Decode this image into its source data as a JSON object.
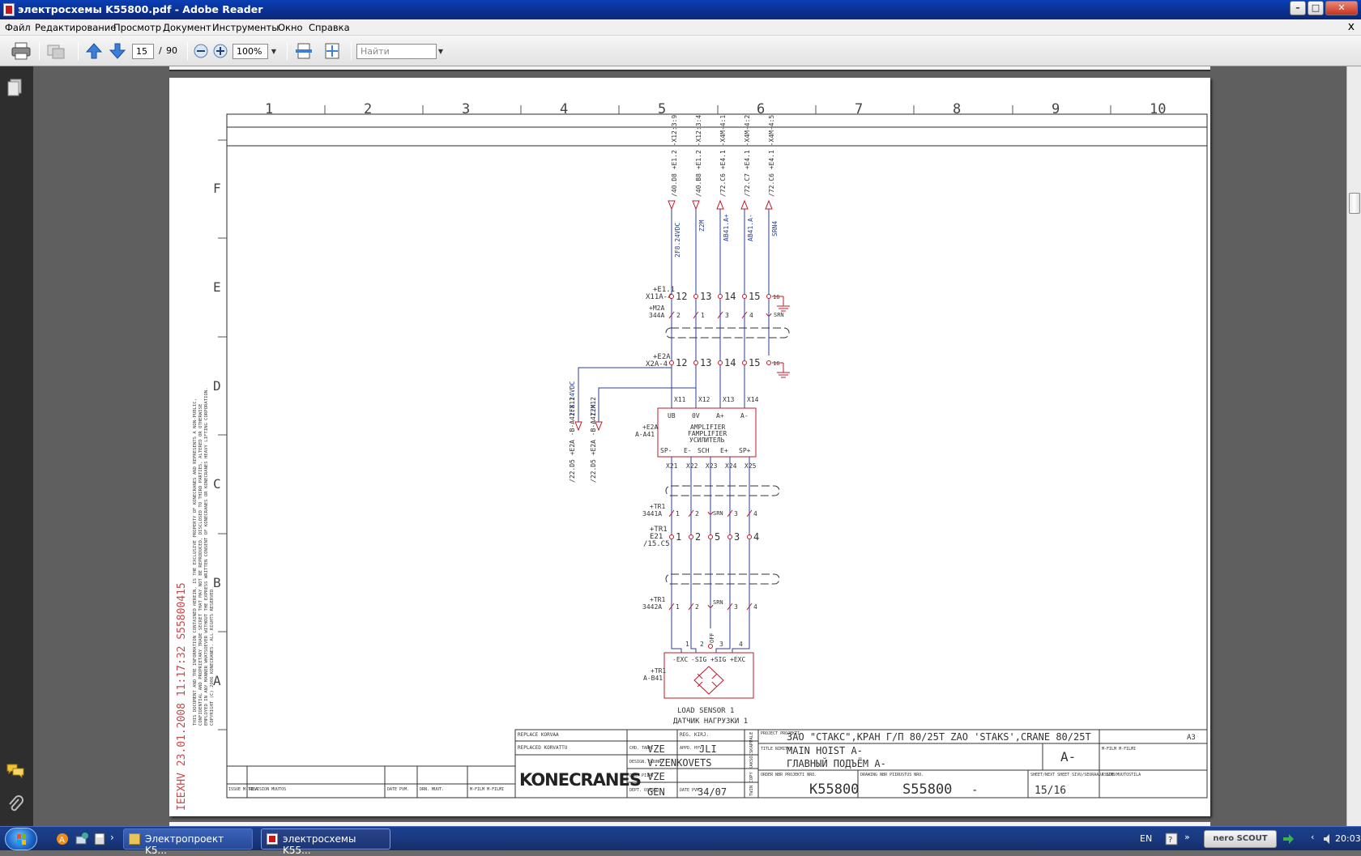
{
  "window": {
    "title": "электросхемы K55800.pdf - Adobe Reader",
    "controls": {
      "minimize": "–",
      "maximize": "□",
      "close": "✕"
    }
  },
  "menu": {
    "items": [
      "Файл",
      "Редактирование",
      "Просмотр",
      "Документ",
      "Инструменты",
      "Окно",
      "Справка"
    ],
    "close_doc": "x"
  },
  "toolbar": {
    "page_current": "15",
    "page_separator": "/",
    "page_total": "90",
    "zoom": "100%",
    "search_placeholder": "Найти"
  },
  "drawing": {
    "columns": [
      "1",
      "2",
      "3",
      "4",
      "5",
      "6",
      "7",
      "8",
      "9",
      "10"
    ],
    "rows": [
      "F",
      "E",
      "D",
      "C",
      "B",
      "A"
    ],
    "top_refs": [
      "/40.D8 +E1.2 -X12:3:9",
      "/40.B8 +E1.2 -X12:3:4",
      "/72.C6 +E4.1 -X4M-4:1",
      "/72.C7 +E4.1 -X4M-4:2",
      "/72.C6 +E4.1 -X4M-4:5"
    ],
    "wire_labels": [
      "2F8.24VDC",
      "Z2M",
      "AB41.A+",
      "AB41.A-",
      "SRN4"
    ],
    "x11a": {
      "loc": "+E1.1",
      "tag": "X11A-4",
      "terms": [
        "12",
        "13",
        "14",
        "15",
        "16"
      ]
    },
    "cable344a": {
      "loc": "+M2A",
      "tag": "344A",
      "cores": [
        "2",
        "1",
        "3",
        "4",
        "SRN"
      ]
    },
    "x2a": {
      "loc": "+E2A",
      "tag": "X2A-4",
      "terms": [
        "12",
        "13",
        "14",
        "15",
        "16"
      ]
    },
    "left_refs": [
      "2F8.24VDC",
      "Z2M",
      "/22.D5 +E2A -B-A41:X11",
      "/22.D5 +E2A -B-A41:X12"
    ],
    "amplifier": {
      "top_terms": [
        "X11",
        "X12",
        "X13",
        "X14"
      ],
      "top_pins": [
        "UB",
        "0V",
        "A+",
        "A-"
      ],
      "loc": "+E2A",
      "tag": "A-A41",
      "name_lines": [
        "AMPLIFIER",
        "FAMPLIFIER",
        "УСИЛИТЕЛЬ"
      ],
      "bottom_pins": [
        "SP-",
        "E-",
        "SCH",
        "E+",
        "SP+"
      ],
      "bottom_terms": [
        "X21",
        "X22",
        "X23",
        "X24",
        "X25"
      ]
    },
    "cable3441a": {
      "loc": "+TR1",
      "tag": "3441A",
      "cores": [
        "1",
        "2",
        "SRN",
        "3",
        "4"
      ]
    },
    "e21": {
      "loc": "+TR1",
      "tag": "E21",
      "ref": "/15.C5",
      "terms": [
        "1",
        "2",
        "5",
        "3",
        "4"
      ]
    },
    "cable3442a": {
      "loc": "+TR1",
      "tag": "3442A",
      "cores": [
        "1",
        "2",
        "SRN",
        "3",
        "4"
      ]
    },
    "sensor": {
      "terms": [
        "1",
        "2",
        "3",
        "4"
      ],
      "off": "OFF",
      "pins": [
        "-EXC",
        "-SIG",
        "+SIG",
        "+EXC"
      ],
      "loc": "+TR1",
      "tag": "A-B41",
      "caption1": "LOAD SENSOR 1",
      "caption2": "ДАТЧИК НАГРУЗКИ 1"
    },
    "margin_stamp": "IEEXHV 23.01.2008 11:17:32 S55800415",
    "copyright_lines": [
      "THIS DOCUMENT AND THE INFORMATION CONTAINED HEREIN, IS THE EXCLUSIVE PROPERTY OF KONECRANES AND REPRESENTS A NON-PUBLIC,",
      "CONFIDENTIAL AND PROPRIETARY TRADE SECRET THAT MAY NOT BE REPRODUCED, DISCLOSED TO THIRD PARTIES, ALTERED OR OTHERWISE",
      "EMPLOYED IN ANY MANNER WHATSOEVER WITHOUT THE EXPRESS WRITTEN CONSENT OF KONECRANES OR KONECRANES HEAVY LIFTING CORPORATION.",
      "COPYRIGHT (C) 2006 KONECRANES. ALL RIGHTS RESERVED."
    ],
    "title_block": {
      "replace": "REPLACE KORVAA",
      "replaced": "REPLACED KORVATTU",
      "reg": "REG. KIRJ.",
      "chk_lbl": "CHD. TARK.",
      "chk": "VZE",
      "app_lbl": "APPD. HYV.",
      "app": "JLI",
      "design_lbl": "DESIGN. SUUNN.",
      "design": "V.ZENKOVETS",
      "drw_lbl": "DRW. PIIRT.",
      "drw": "VZE",
      "dept_lbl": "DEPT. OSASTO",
      "dept": "GEN",
      "date_lbl": "DATE PVM.",
      "date": "34/07",
      "logo": "KONECRANES",
      "twin": "TWIN COPY KAKSOISKAPPALE",
      "project_lbl": "PROJECT PROJEKTI",
      "project": "ЗАО \"СТАКС\",КРАН Г/П 80/25Т ZAO 'STAKS',CRANE 80/25T",
      "size": "A3",
      "title_lbl": "TITLE NIMITYS",
      "title1": "MAIN HOIST A-",
      "title2": "ГЛАВНЫЙ ПОДЪЁМ A-",
      "title_code": "A-",
      "film": "M-FILM M-FILMI",
      "order_lbl": "ORDER NBR PROJEKTI NRO.",
      "order": "K55800",
      "drawing_lbl": "DRAWING NBR PIIRUSTUS NRO.",
      "drawing": "S55800",
      "drawing_suffix": "-",
      "sheet_lbl": "SHEET/NEXT SHEET SIVU/SEURAAVA SIVU",
      "sheet": "15/16",
      "issue_lbl": "ISSUE MUUTOSTILA",
      "rev_cols": [
        "ISSUE M-TILA",
        "REVISION MUUTOS",
        "DATE PVM.",
        "DRN. MUUT.",
        "M-FILM M-FILMI"
      ]
    }
  },
  "taskbar": {
    "tasks": [
      "Электропроект K5...",
      "электросхемы K55..."
    ],
    "lang": "EN",
    "tray_brand": "nero SCOUT",
    "clock": "20:03"
  },
  "colors": {
    "wire_blue": "#2b3f9a",
    "wire_red": "#c0182b",
    "ink": "#2a2a2a",
    "stamp": "#c44a4a",
    "titlebar": "#0b2f8f"
  }
}
